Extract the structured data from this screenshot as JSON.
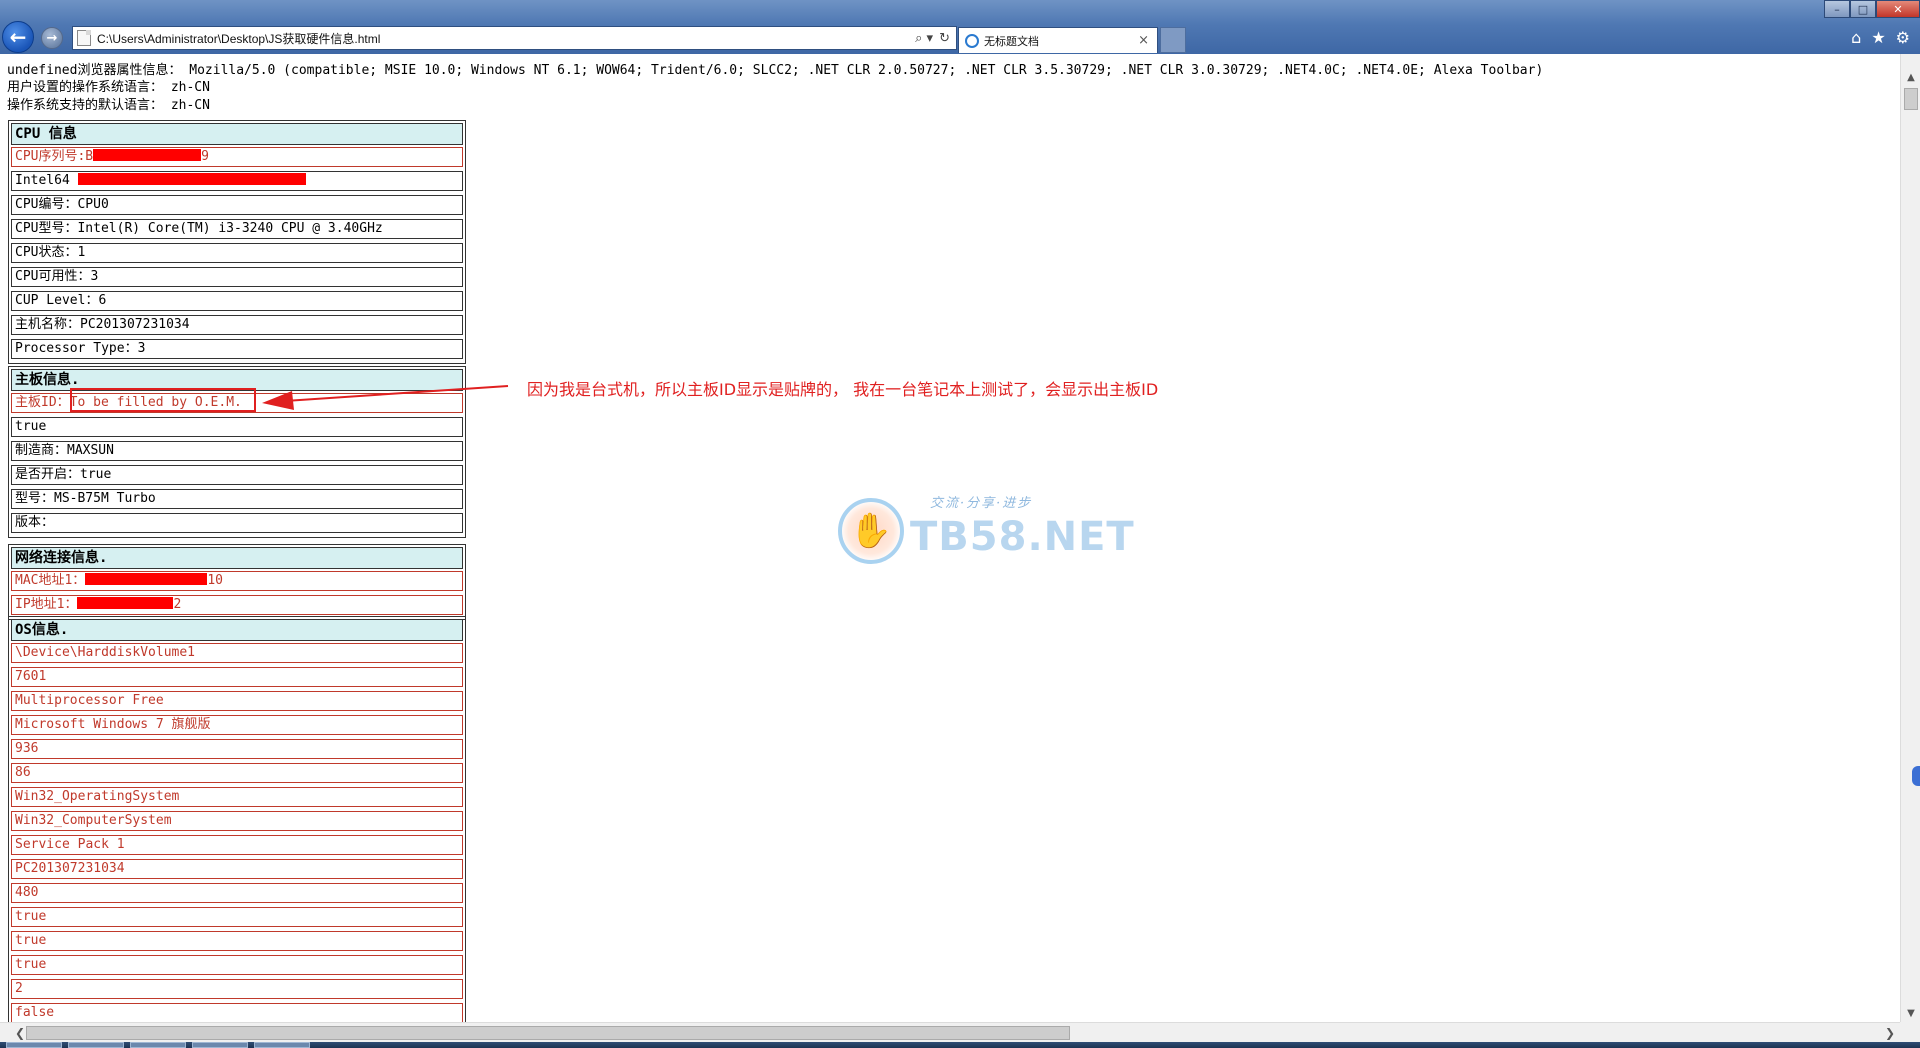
{
  "browser": {
    "address": "C:\\Users\\Administrator\\Desktop\\JS获取硬件信息.html",
    "tab_title": "无标题文档",
    "tab_close": "×",
    "back_glyph": "←",
    "forward_glyph": "→",
    "search_glyph": "⌕ ▾",
    "refresh_glyph": "↻",
    "window_controls": {
      "minimize": "–",
      "maximize": "□",
      "close": "✕"
    },
    "tool_icons": {
      "home": "⌂",
      "favorites": "★",
      "tools": "⚙"
    },
    "icons": [
      "back-icon",
      "forward-icon",
      "page-icon",
      "search-icon",
      "refresh-icon",
      "ie-icon",
      "close-icon",
      "home-icon",
      "star-icon",
      "gear-icon"
    ]
  },
  "info": {
    "ua_line": "undefined浏览器属性信息： Mozilla/5.0 (compatible; MSIE 10.0; Windows NT 6.1; WOW64; Trident/6.0; SLCC2; .NET CLR 2.0.50727; .NET CLR 3.5.30729; .NET CLR 3.0.30729; .NET4.0C; .NET4.0E; Alexa Toolbar)",
    "user_lang_line": "用户设置的操作系统语言： zh-CN",
    "sys_lang_line": "操作系统支持的默认语言： zh-CN"
  },
  "cpu": {
    "title": "CPU 信息",
    "serial_prefix": "CPU序列号:B",
    "serial_suffix": "9",
    "intel_prefix": "Intel64 ",
    "rows": [
      "CPU编号：CPU0",
      "CPU型号：Intel(R) Core(TM) i3-3240 CPU @ 3.40GHz",
      "CPU状态：1",
      "CPU可用性：3",
      "CUP Level：6",
      "主机名称：PC201307231034",
      "Processor Type：3"
    ]
  },
  "board": {
    "title": "主板信息.",
    "id_label": "主板ID：",
    "id_value": "To be filled by O.E.M.",
    "rows": [
      "true",
      "制造商：MAXSUN",
      "是否开启：true",
      "型号：MS-B75M Turbo",
      "版本："
    ]
  },
  "network": {
    "title": "网络连接信息.",
    "mac_prefix": "MAC地址1：",
    "mac_suffix": "10",
    "ip_prefix": "IP地址1：",
    "ip_suffix": "2"
  },
  "os": {
    "title": "OS信息.",
    "rows": [
      "\\Device\\HarddiskVolume1",
      "7601",
      "Multiprocessor Free",
      "Microsoft Windows 7 旗舰版",
      "936",
      "86",
      "Win32_OperatingSystem",
      "Win32_ComputerSystem",
      "Service Pack 1",
      "PC201307231034",
      "480",
      "true",
      "true",
      "true",
      "2",
      "false"
    ]
  },
  "annotation": {
    "text": "因为我是台式机，所以主板ID显示是贴牌的， 我在一台笔记本上测试了，会显示出主板ID",
    "color": "#e02020"
  },
  "watermark": {
    "slogan": "交流·分享·进步",
    "text": "TB58.NET",
    "hand_glyph": "✋"
  },
  "scrollbar": {
    "up": "▲",
    "down": "▼",
    "left": "❮",
    "right": "❯"
  },
  "colors": {
    "section_bg": "#d6f0f1",
    "red_text": "#c0392b",
    "mask": "#ff0000",
    "titlebar": "#4f78b3"
  }
}
